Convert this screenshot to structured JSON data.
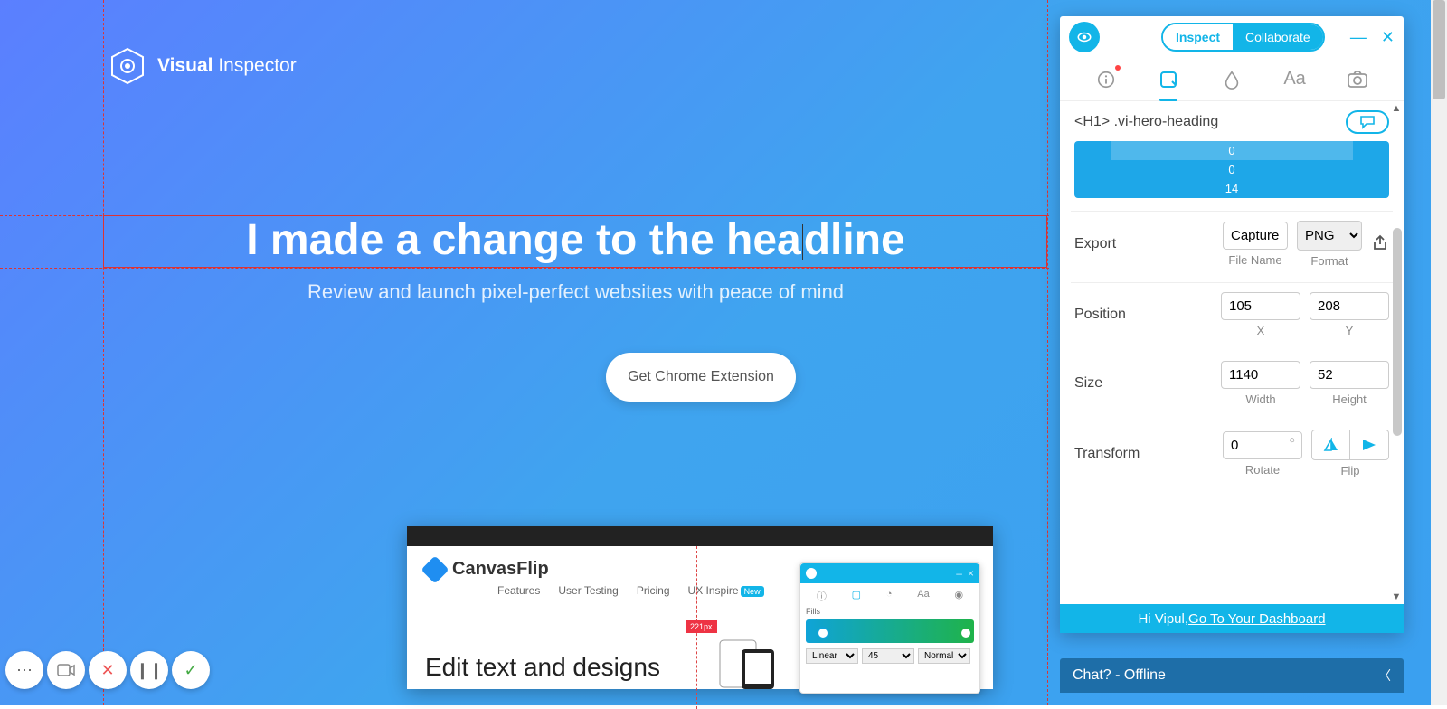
{
  "brand": {
    "name_bold": "Visual",
    "name_light": "Inspector"
  },
  "hero": {
    "headline_pre": "I made a change to the hea",
    "headline_post": "dline",
    "subtitle": "Review and launch pixel-perfect websites with peace of mind",
    "cta": "Get Chrome Extension"
  },
  "preview": {
    "brand": "CanvasFlip",
    "nav": [
      "Features",
      "User Testing",
      "Pricing",
      "UX Inspire"
    ],
    "nav_badge": "New",
    "heading": "Edit text and designs",
    "badge": "221px",
    "selects": {
      "a": "Linear",
      "b": "45",
      "c": "Normal"
    },
    "tab_fills": "Fills"
  },
  "inspector": {
    "mode": {
      "inspect": "Inspect",
      "collaborate": "Collaborate"
    },
    "selector": "<H1> .vi-hero-heading",
    "box": {
      "top": "0",
      "mid": "0",
      "bot": "14"
    },
    "export": {
      "label": "Export",
      "capture": "Capture",
      "format": "PNG",
      "file_name_label": "File Name",
      "format_label": "Format"
    },
    "position": {
      "label": "Position",
      "x": "105",
      "y": "208",
      "xlabel": "X",
      "ylabel": "Y"
    },
    "size": {
      "label": "Size",
      "w": "1140",
      "h": "52",
      "wlabel": "Width",
      "hlabel": "Height"
    },
    "transform": {
      "label": "Transform",
      "rotate": "0",
      "rotate_label": "Rotate",
      "flip_label": "Flip"
    },
    "footer": {
      "greeting": "Hi Vipul, ",
      "link": "Go To Your Dashboard"
    }
  },
  "chat": {
    "label": "Chat? - Offline"
  }
}
